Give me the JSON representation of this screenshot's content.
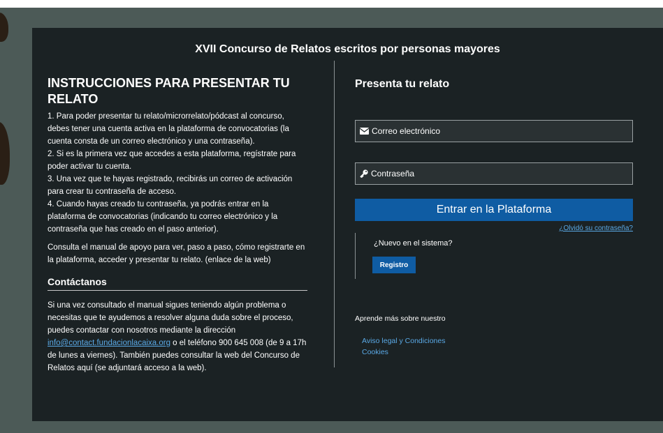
{
  "page": {
    "title": "XVII Concurso de Relatos escritos por personas mayores"
  },
  "instructions": {
    "heading": "INSTRUCCIONES PARA PRESENTAR TU RELATO",
    "steps": [
      "1. Para poder presentar tu relato/microrrelato/pódcast al concurso, debes tener una cuenta activa en la plataforma de convocatorias (la cuenta consta de un correo electrónico y una contraseña).",
      "2. Si es la primera vez que accedes a esta plataforma, regístrate para poder activar tu cuenta.",
      "3. Una vez que te hayas registrado, recibirás un correo de activación para crear tu contraseña de acceso.",
      "4. Cuando hayas creado tu contraseña, ya podrás entrar en la plataforma de convocatorias (indicando tu correo electrónico y la contraseña que has creado en el paso anterior)."
    ],
    "manual_note": "Consulta el manual de apoyo para ver, paso a paso, cómo registrarte en la plataforma, acceder y presentar tu relato. (enlace de la web)"
  },
  "contact": {
    "heading": "Contáctanos",
    "text_before": "Si una vez consultado el manual sigues teniendo algún problema o necesitas que te ayudemos a resolver alguna duda sobre el proceso, puedes contactar con nosotros mediante la dirección ",
    "email": "info@contact.fundacionlacaixa.org",
    "text_after": " o el teléfono 900 645 008 (de 9 a 17h de lunes a viernes). También puedes consultar la web del Concurso de Relatos aquí (se adjuntará acceso a la web)."
  },
  "login": {
    "heading": "Presenta tu relato",
    "email_placeholder": "Correo electrónico",
    "password_placeholder": "Contraseña",
    "submit_label": "Entrar en la Plataforma",
    "forgot_label": "¿Olvidó su contraseña?",
    "new_user_label": "¿Nuevo en el sistema?",
    "register_label": "Registro"
  },
  "footer": {
    "learn_more": "Aprende más sobre nuestro",
    "links": [
      "Aviso legal y Condiciones",
      "Cookies"
    ]
  },
  "icons": {
    "email": "envelope-icon",
    "password": "key-icon"
  },
  "colors": {
    "panel_bg": "#1b2224",
    "backdrop": "#4c5a57",
    "primary_button": "#0f5ca3",
    "link": "#5aa9e6"
  }
}
